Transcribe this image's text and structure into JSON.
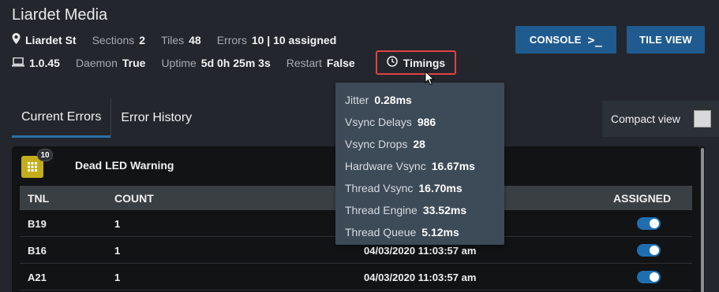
{
  "header": {
    "title": "Liardet Media",
    "location": "Liardet St",
    "sections_label": "Sections",
    "sections_value": "2",
    "tiles_label": "Tiles",
    "tiles_value": "48",
    "errors_label": "Errors",
    "errors_value": "10 | 10 assigned",
    "version": "1.0.45",
    "daemon_label": "Daemon",
    "daemon_value": "True",
    "uptime_label": "Uptime",
    "uptime_value": "5d 0h 25m 3s",
    "restart_label": "Restart",
    "restart_value": "False",
    "timings_label": "Timings"
  },
  "buttons": {
    "console": "CONSOLE",
    "console_prompt": ">_",
    "tile_view": "TILE VIEW"
  },
  "tabs": [
    {
      "label": "Current Errors",
      "active": true
    },
    {
      "label": "Error History",
      "active": false
    }
  ],
  "compact_view": {
    "label": "Compact view",
    "checked": false
  },
  "error_group": {
    "title": "Dead LED Warning",
    "count": "10",
    "columns": {
      "tnl": "TNL",
      "count": "COUNT",
      "assigned": "ASSIGNED"
    },
    "rows": [
      {
        "tnl": "B19",
        "count": "1",
        "date": "",
        "assigned": true
      },
      {
        "tnl": "B16",
        "count": "1",
        "date": "04/03/2020 11:03:57 am",
        "assigned": true
      },
      {
        "tnl": "A21",
        "count": "1",
        "date": "04/03/2020 11:03:57 am",
        "assigned": true
      }
    ]
  },
  "timings_tooltip": [
    {
      "label": "Jitter",
      "value": "0.28ms"
    },
    {
      "label": "Vsync Delays",
      "value": "986"
    },
    {
      "label": "Vsync Drops",
      "value": "28"
    },
    {
      "label": "Hardware Vsync",
      "value": "16.67ms"
    },
    {
      "label": "Thread Vsync",
      "value": "16.70ms"
    },
    {
      "label": "Thread Engine",
      "value": "33.52ms"
    },
    {
      "label": "Thread Queue",
      "value": "5.12ms"
    }
  ],
  "icons": {
    "location": "map-pin-icon",
    "version": "laptop-icon",
    "timings": "clock-icon",
    "error_group": "grid-icon",
    "cursor": "mouse-pointer-icon"
  },
  "colors": {
    "background": "#23272d",
    "accent_blue": "#1f5b8f",
    "toggle_on": "#1f6fb0",
    "highlight_red": "#e04242",
    "warning_yellow": "#c3ad1a",
    "tooltip_bg": "#3d4a57"
  }
}
